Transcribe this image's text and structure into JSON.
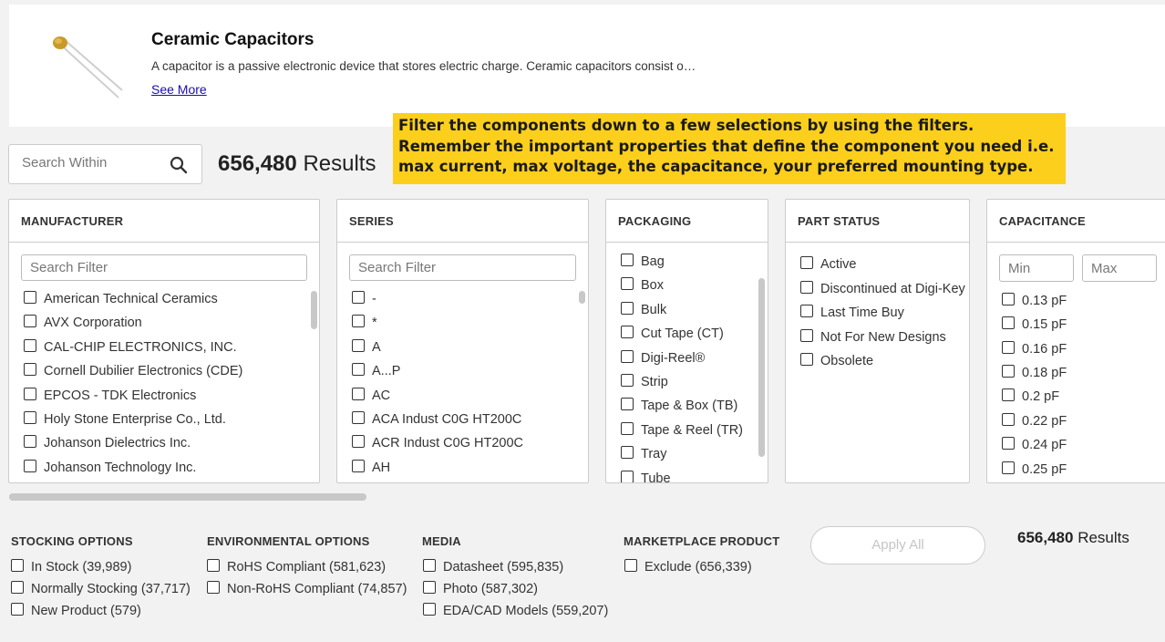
{
  "header": {
    "title": "Ceramic Capacitors",
    "description": "A capacitor is a passive electronic device that stores electric charge. Ceramic capacitors consist o…",
    "see_more": "See More"
  },
  "callout": {
    "text": "Filter the components down to a few selections by using the filters. Remember the important properties that define the component you need i.e. max current, max voltage, the capacitance, your preferred mounting type."
  },
  "search_within": {
    "placeholder": "Search Within"
  },
  "results": {
    "count": "656,480",
    "label": "Results"
  },
  "filters": {
    "manufacturer": {
      "title": "MANUFACTURER",
      "placeholder": "Search Filter",
      "options": [
        "American Technical Ceramics",
        "AVX Corporation",
        "CAL-CHIP ELECTRONICS, INC.",
        "Cornell Dubilier Electronics (CDE)",
        "EPCOS - TDK Electronics",
        "Holy Stone Enterprise Co., Ltd.",
        "Johanson Dielectrics Inc.",
        "Johanson Technology Inc."
      ]
    },
    "series": {
      "title": "SERIES",
      "placeholder": "Search Filter",
      "options": [
        "-",
        "*",
        "A",
        "A...P",
        "AC",
        "ACA Indust C0G HT200C",
        "ACR Indust C0G HT200C",
        "AH"
      ]
    },
    "packaging": {
      "title": "PACKAGING",
      "options": [
        "Bag",
        "Box",
        "Bulk",
        "Cut Tape (CT)",
        "Digi-Reel®",
        "Strip",
        "Tape & Box (TB)",
        "Tape & Reel (TR)",
        "Tray",
        "Tube"
      ]
    },
    "part_status": {
      "title": "PART STATUS",
      "options": [
        "Active",
        "Discontinued at Digi-Key",
        "Last Time Buy",
        "Not For New Designs",
        "Obsolete"
      ]
    },
    "capacitance": {
      "title": "CAPACITANCE",
      "min_placeholder": "Min",
      "max_placeholder": "Max",
      "options": [
        "0.13 pF",
        "0.15 pF",
        "0.16 pF",
        "0.18 pF",
        "0.2 pF",
        "0.22 pF",
        "0.24 pF",
        "0.25 pF"
      ]
    }
  },
  "stocking": {
    "title": "STOCKING OPTIONS",
    "options": [
      "In Stock (39,989)",
      "Normally Stocking (37,717)",
      "New Product (579)"
    ]
  },
  "environmental": {
    "title": "ENVIRONMENTAL OPTIONS",
    "options": [
      "RoHS Compliant (581,623)",
      "Non-RoHS Compliant (74,857)"
    ]
  },
  "media": {
    "title": "MEDIA",
    "options": [
      "Datasheet (595,835)",
      "Photo (587,302)",
      "EDA/CAD Models (559,207)"
    ]
  },
  "marketplace": {
    "title": "MARKETPLACE PRODUCT",
    "options": [
      "Exclude (656,339)"
    ]
  },
  "apply_all": "Apply All",
  "colors": {
    "callout_bg": "#fccf1c",
    "link": "#1a0dab"
  }
}
